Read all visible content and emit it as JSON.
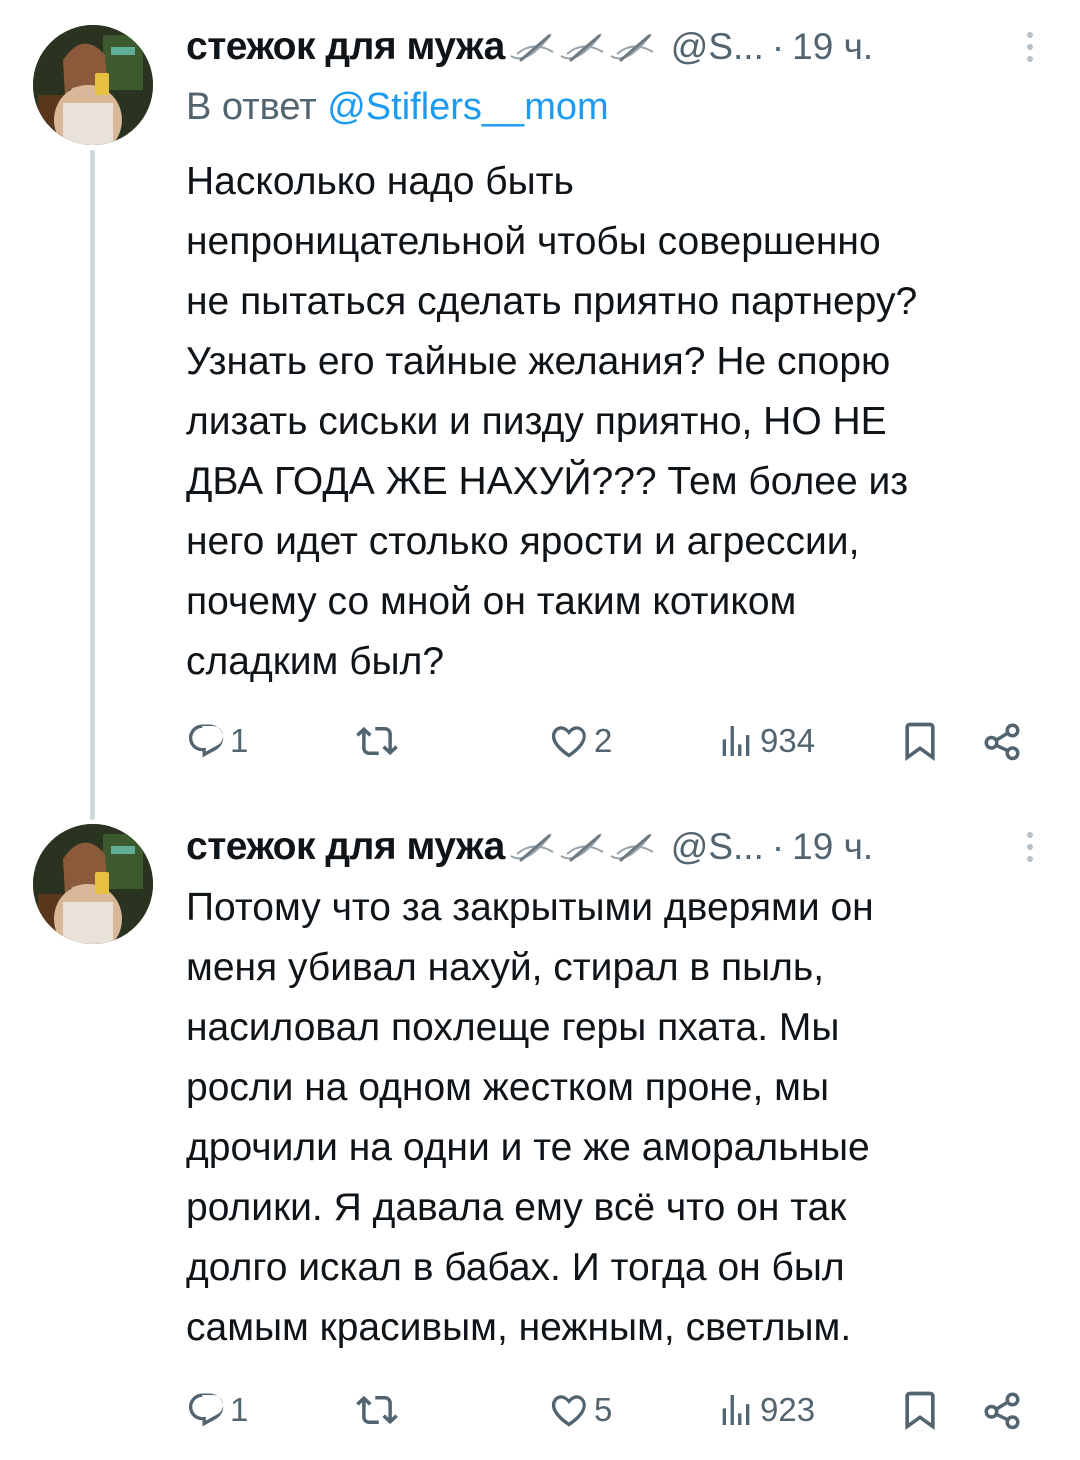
{
  "tweets": [
    {
      "author_name": "стежок для мужа",
      "author_emoji": "needle-thread-icon",
      "handle": "@S...",
      "separator": "·",
      "time": "19 ч.",
      "reply_prefix": "В ответ",
      "reply_mention": "@Stiflers__mom",
      "text": "Насколько надо быть\nнепроницательной чтобы совершенно\nне пытаться сделать приятно партнеру?\nУзнать его тайные желания? Не спорю\nлизать сиськи и пизду приятно, НО НЕ\nДВА ГОДА ЖЕ НАХУЙ??? Тем более из\nнего идет столько ярости и агрессии,\nпочему со мной он таким котиком\nсладким был?",
      "replies": "1",
      "retweets": "",
      "likes": "2",
      "views": "934"
    },
    {
      "author_name": "стежок для мужа",
      "author_emoji": "needle-thread-icon",
      "handle": "@S...",
      "separator": "·",
      "time": "19 ч.",
      "text": "Потому что за закрытыми дверями он\nменя убивал нахуй, стирал в пыль,\nнасиловал похлеще геры пхата. Мы\nросли на одном жестком проне, мы\nдрочили на одни и те же аморальные\nролики. Я давала ему всё что он так\nдолго искал в бабах. И тогда он был\nсамым красивым, нежным, светлым.",
      "replies": "1",
      "retweets": "",
      "likes": "5",
      "views": "923"
    }
  ],
  "colors": {
    "text": "#0f1419",
    "secondary": "#536471",
    "link": "#1d9bf0",
    "thread_line": "#cfd9de"
  }
}
